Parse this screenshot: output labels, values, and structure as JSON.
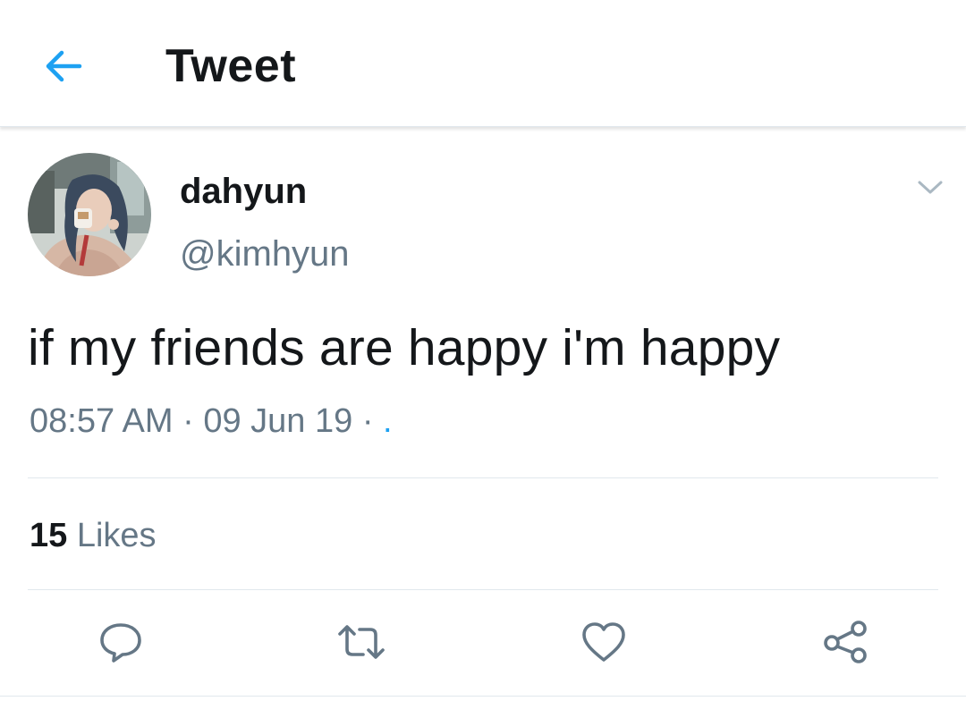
{
  "header": {
    "back_icon": "arrow-left-icon",
    "title": "Tweet"
  },
  "tweet": {
    "author": {
      "display_name": "dahyun",
      "handle": "@kimhyun",
      "avatar": "profile-photo"
    },
    "more_icon": "chevron-down-icon",
    "text": "if my friends are happy i'm happy",
    "time": "08:57 AM",
    "date": "09 Jun 19",
    "separator": " · ",
    "source": ".",
    "likes": {
      "count": "15",
      "label": "Likes"
    },
    "actions": [
      {
        "name": "reply",
        "icon": "reply-icon"
      },
      {
        "name": "retweet",
        "icon": "retweet-icon"
      },
      {
        "name": "like",
        "icon": "heart-icon"
      },
      {
        "name": "share",
        "icon": "share-icon"
      }
    ]
  },
  "colors": {
    "accent": "#1da1f2",
    "text_primary": "#14171a",
    "text_secondary": "#657786",
    "icon_gray": "#657786",
    "divider": "#e1e8ed"
  }
}
